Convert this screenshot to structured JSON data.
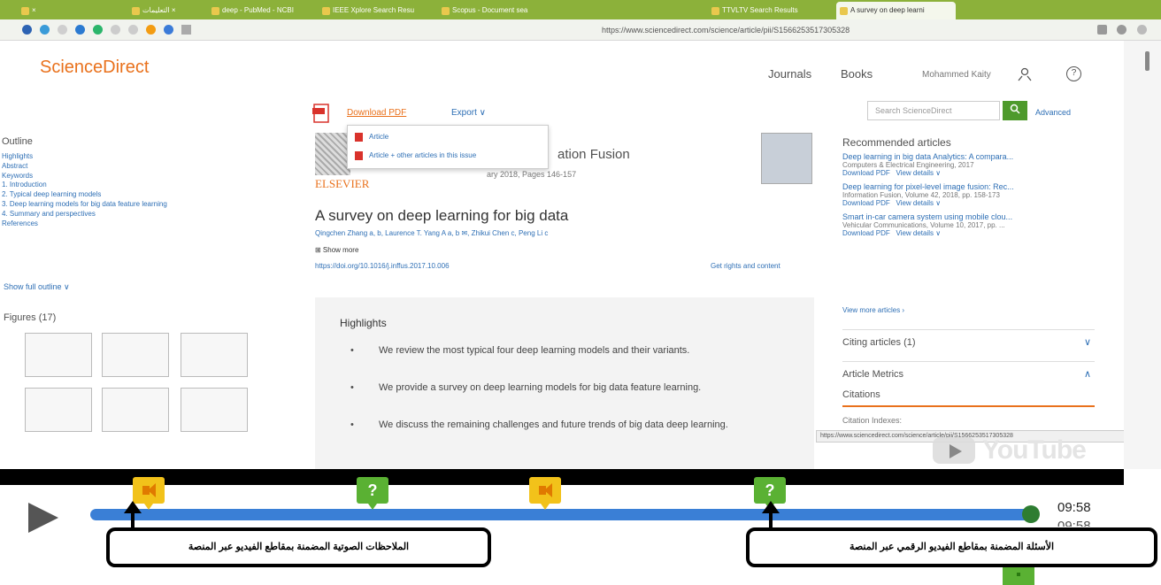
{
  "browser": {
    "tabs": [
      {
        "label": "×"
      },
      {
        "label": "التعليمات ×"
      },
      {
        "label": "deep - PubMed - NCBI"
      },
      {
        "label": "IEEE Xplore Search Resu"
      },
      {
        "label": "Scopus - Document sea"
      },
      {
        "label": "TTVLTV Search Results"
      },
      {
        "label": "A survey on deep learni"
      }
    ],
    "url": "https://www.sciencedirect.com/science/article/pii/S1566253517305328"
  },
  "header": {
    "logo": "ScienceDirect",
    "journals": "Journals",
    "books": "Books",
    "user": "Mohammed Kaity",
    "help": "?"
  },
  "toolbar": {
    "download_pdf": "Download PDF",
    "export": "Export ∨",
    "search_placeholder": "Search ScienceDirect",
    "advanced": "Advanced"
  },
  "dropdown": {
    "items": [
      "Article",
      "Article + other articles in this issue"
    ]
  },
  "outline": {
    "title": "Outline",
    "items": [
      "Highlights",
      "Abstract",
      "Keywords",
      "1. Introduction",
      "2. Typical deep learning models",
      "3. Deep learning models for big data feature learning",
      "4. Summary and perspectives",
      "References"
    ],
    "show_full": "Show full outline ∨",
    "figures": "Figures (17)"
  },
  "article": {
    "publisher": "ELSEVIER",
    "journal": "ation Fusion",
    "volume": "ary 2018, Pages 146-157",
    "title": "A survey on deep learning for big data",
    "authors": "Qingchen Zhang a, b, Laurence T. Yang A a, b ✉, Zhikui Chen c, Peng Li c",
    "show_more": "⊞ Show more",
    "doi": "https://doi.org/10.1016/j.inffus.2017.10.006",
    "rights": "Get rights and content",
    "highlights_title": "Highlights",
    "highlights": [
      "We review the most typical four deep learning models and their variants.",
      "We provide a survey on deep learning models for big data feature learning.",
      "We discuss the remaining challenges and future trends of big data deep learning."
    ]
  },
  "sidebar": {
    "recommended": "Recommended articles",
    "articles": [
      {
        "title": "Deep learning in big data Analytics: A compara...",
        "source": "Computers & Electrical Engineering, 2017"
      },
      {
        "title": "Deep learning for pixel-level image fusion: Rec...",
        "source": "Information Fusion, Volume 42, 2018, pp. 158-173"
      },
      {
        "title": "Smart in-car camera system using mobile clou...",
        "source": "Vehicular Communications, Volume 10, 2017, pp. ..."
      }
    ],
    "download_pdf": "Download PDF",
    "view_details": "View details ∨",
    "view_more": "View more articles ›",
    "citing": "Citing articles (1)",
    "metrics": "Article Metrics",
    "citations": "Citations",
    "citation_indexes": "Citation Indexes:",
    "status_url": "https://www.sciencedirect.com/science/article/pii/S1566253517305328",
    "youtube": "YouTube"
  },
  "player": {
    "time": "09:58",
    "time_ghost": "09:58",
    "progress": 1.0,
    "markers": [
      {
        "type": "audio-note",
        "symbol": ""
      },
      {
        "type": "question",
        "symbol": "?"
      },
      {
        "type": "audio-note",
        "symbol": ""
      },
      {
        "type": "question",
        "symbol": "?"
      }
    ],
    "callout_audio": "الملاحظات الصوتية المضمنة بمقاطع الفيديو عبر المنصة",
    "callout_questions": "الأسئلة المضمنة بمقاطع الفيديو الرقمي عبر المنصة"
  },
  "colors": {
    "accent": "#e9711c",
    "link": "#2e6fb5",
    "track": "#3a7fd6",
    "question_marker": "#5ab133",
    "audio_marker": "#f2c21a"
  }
}
